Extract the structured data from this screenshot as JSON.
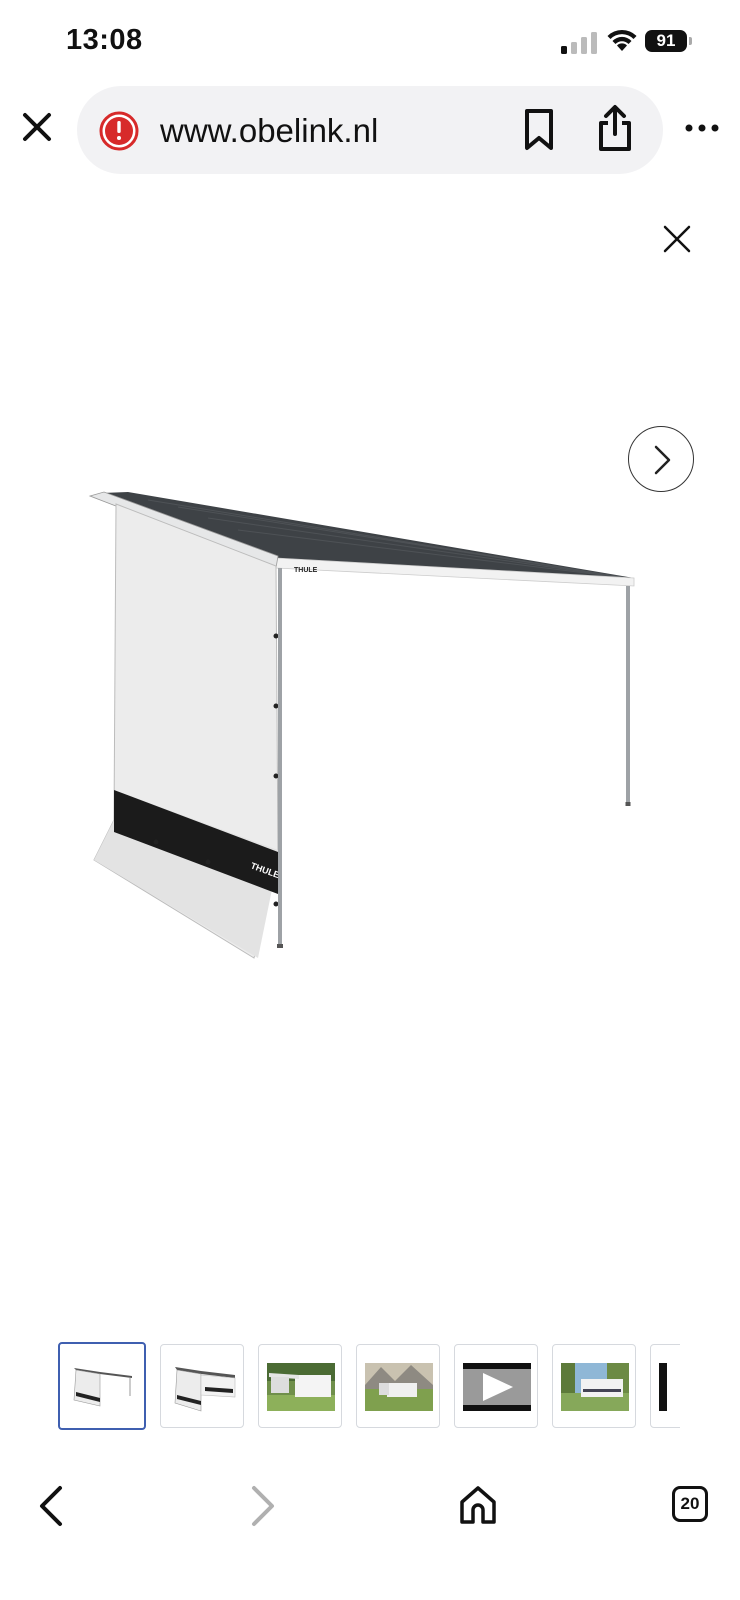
{
  "status_bar": {
    "time": "13:08",
    "battery": "91"
  },
  "browser": {
    "url": "www.obelink.nl"
  },
  "gallery": {
    "main_image_alt_icon": "awning-side-wall-image",
    "awning_brand": "THULE",
    "thumbnails": [
      {
        "kind": "side-wall-product",
        "active": true
      },
      {
        "kind": "side-wall-product-2",
        "active": false
      },
      {
        "kind": "camper-photo",
        "active": false
      },
      {
        "kind": "camper-mountain-photo",
        "active": false
      },
      {
        "kind": "video",
        "active": false
      },
      {
        "kind": "camper-trees-photo",
        "active": false
      },
      {
        "kind": "partial",
        "active": false
      }
    ]
  },
  "toolbar": {
    "tab_count": "20"
  },
  "colors": {
    "accent": "#3f5fb0",
    "warning": "#d72a2a",
    "disabled": "#b0b0b0"
  }
}
